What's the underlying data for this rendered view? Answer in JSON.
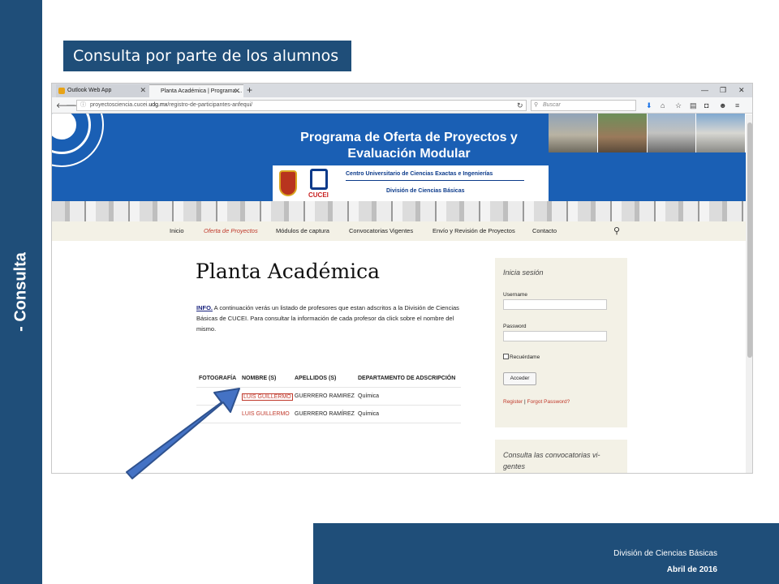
{
  "slide": {
    "side_label": "- Consulta",
    "title": "Consulta por parte de los alumnos",
    "footer_line1": "División de Ciencias Básicas",
    "footer_line2": "Abril de 2016",
    "colors": {
      "dark_blue": "#1f4e79",
      "hero_blue": "#1a5fb4",
      "link_red": "#c0392b",
      "menu_bg": "#f3f1e6"
    }
  },
  "browser": {
    "tabs": [
      {
        "label": "Outlook Web App",
        "close": "✕"
      },
      {
        "label": "Planta Académica | Programa ...",
        "close": "✕"
      }
    ],
    "new_tab": "+",
    "window_controls": [
      "—",
      "❐",
      "✕"
    ],
    "url": {
      "prefix": "proyectosciencia.cucei.",
      "domain": "udg.mx",
      "path": "/registro-de-participantes-anfequi/"
    },
    "search_placeholder": "Buscar",
    "nav_icons": [
      "back-icon",
      "forward-icon",
      "info-icon",
      "reload-icon",
      "search-icon",
      "download-icon",
      "home-icon",
      "bookmark-star-icon",
      "clipboard-icon",
      "pocket-icon",
      "smiley-icon",
      "menu-icon"
    ]
  },
  "site": {
    "header_line1": "Programa de Oferta de Proyectos y",
    "header_line2": "Evaluación Modular",
    "logo_line1": "Centro Universitario de Ciencias Exactas e Ingenierías",
    "logo_line2": "División de Ciencias Básicas",
    "logo_brand": "CUCEI",
    "menu": [
      {
        "label": "Inicio",
        "active": false
      },
      {
        "label": "Oferta de Proyectos",
        "active": true
      },
      {
        "label": "Módulos de captura",
        "active": false
      },
      {
        "label": "Convocatorias Vigentes",
        "active": false
      },
      {
        "label": "Envío y Revisión de Proyectos",
        "active": false
      },
      {
        "label": "Contacto",
        "active": false
      }
    ],
    "page_title": "Planta Académica",
    "info_link": "INFO.",
    "info_text": " A continuación verás un listado de profesores que estan adscritos a la División de Ciencias Básicas de CUCEI. Para consultar la información de cada profesor da click sobre el nombre del mismo.",
    "table": {
      "headers": [
        "FOTOGRAFÍA",
        "NOMBRE (S)",
        "APELLIDOS (S)",
        "DEPARTAMENTO DE ADSCRIPCIÓN"
      ],
      "rows": [
        {
          "photo": "",
          "name": "LUIS GUILLERMO",
          "surname": "GUERRERO RAMIREZ",
          "dept": "Química"
        },
        {
          "photo": "",
          "name": "LUIS GUILLERMO",
          "surname": "GUERRERO RAMÍREZ",
          "dept": "Química"
        }
      ]
    },
    "login": {
      "title": "Inicia sesión",
      "username_label": "Username",
      "password_label": "Password",
      "remember_label": "Recuérdame",
      "submit_label": "Acceder",
      "register_label": "Register",
      "forgot_label": "Forgot Password?"
    },
    "widget2_title": "Consulta las convocatorias vi- gentes"
  }
}
